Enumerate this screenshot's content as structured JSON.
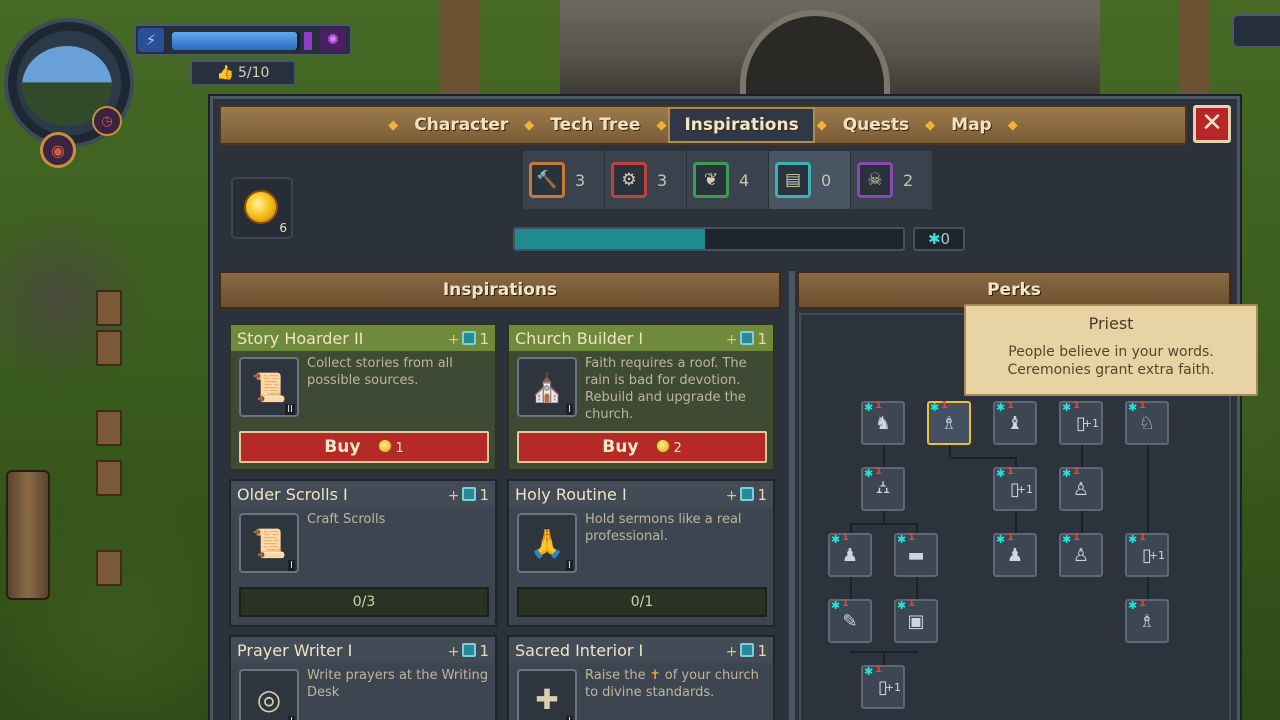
{
  "hud": {
    "energy_fraction": 0.98,
    "reputation": "5/10"
  },
  "nav": {
    "tabs": [
      {
        "label": "Character",
        "active": false
      },
      {
        "label": "Tech Tree",
        "active": false
      },
      {
        "label": "Inspirations",
        "active": true
      },
      {
        "label": "Quests",
        "active": false
      },
      {
        "label": "Map",
        "active": false
      }
    ],
    "close_icon": "close-icon"
  },
  "categories": [
    {
      "icon": "hammer-icon",
      "count": "3",
      "color": "#c77a36"
    },
    {
      "icon": "gear-icon",
      "count": "3",
      "color": "#c0423a"
    },
    {
      "icon": "wheat-icon",
      "count": "4",
      "color": "#3f9a52"
    },
    {
      "icon": "book-icon",
      "count": "0",
      "color": "#3eb0b8"
    },
    {
      "icon": "skull-icon",
      "count": "2",
      "color": "#8a4ab2"
    }
  ],
  "currency": {
    "orb_count": "6"
  },
  "progress": {
    "fraction": 0.49,
    "xp": "0"
  },
  "sections": {
    "inspirations": "Inspirations",
    "perks": "Perks"
  },
  "cards": [
    {
      "title": "Story Hoarder II",
      "plus": "1",
      "desc": "Collect stories from all possible sources.",
      "badge": "II",
      "icon": "scroll-icon",
      "style": "green",
      "action": "buy",
      "buy_label": "Buy",
      "cost": "1"
    },
    {
      "title": "Church Builder I",
      "plus": "1",
      "desc": "Faith requires a roof. The rain is bad for devotion. Rebuild and upgrade the church.",
      "badge": "I",
      "icon": "church-icon",
      "style": "green",
      "action": "buy",
      "buy_label": "Buy",
      "cost": "2"
    },
    {
      "title": "Older Scrolls I",
      "plus": "1",
      "desc": "Craft Scrolls",
      "badge": "I",
      "icon": "parchment-icon",
      "style": "grey",
      "action": "progress",
      "progress": "0/3"
    },
    {
      "title": "Holy Routine I",
      "plus": "1",
      "desc": "Hold sermons like a real professional.",
      "badge": "I",
      "icon": "prayer-hands-icon",
      "style": "grey",
      "action": "progress",
      "progress": "0/1"
    },
    {
      "title": "Prayer Writer I",
      "plus": "1",
      "desc": "Write prayers at the Writing Desk",
      "badge": "I",
      "icon": "swirl-orb-icon",
      "style": "grey",
      "action": "none"
    },
    {
      "title": "Sacred Interior I",
      "plus": "1",
      "desc_pre": "Raise the",
      "desc_post": "of your church to divine standards.",
      "badge": "I",
      "icon": "church-interior-icon",
      "style": "grey",
      "action": "none"
    }
  ],
  "tooltip": {
    "title": "Priest",
    "desc_line1": "People believe in your words.",
    "desc_line2": "Ceremonies grant extra faith."
  },
  "perks": [
    {
      "col": 0,
      "row": 0,
      "num": "1",
      "icon": "knight-icon",
      "plus": ""
    },
    {
      "col": 1,
      "row": 0,
      "num": "1",
      "icon": "priest-icon",
      "plus": "",
      "selected": true
    },
    {
      "col": 2,
      "row": 0,
      "num": "1",
      "icon": "monk-icon",
      "plus": ""
    },
    {
      "col": 3,
      "row": 0,
      "num": "1",
      "icon": "scroll-perk-icon",
      "plus": "+1"
    },
    {
      "col": 4,
      "row": 0,
      "num": "1",
      "icon": "cleric-icon",
      "plus": ""
    },
    {
      "col": 0,
      "row": 1,
      "num": "1",
      "icon": "altar-icon",
      "plus": ""
    },
    {
      "col": 2,
      "row": 1,
      "num": "1",
      "icon": "scroll-perk-icon",
      "plus": "+1"
    },
    {
      "col": 3,
      "row": 1,
      "num": "1",
      "icon": "preacher-icon",
      "plus": ""
    },
    {
      "col": -0.5,
      "row": 2,
      "num": "1",
      "icon": "villager-icon",
      "plus": ""
    },
    {
      "col": 0.5,
      "row": 2,
      "num": "1",
      "icon": "pulpit-icon",
      "plus": ""
    },
    {
      "col": 2,
      "row": 2,
      "num": "1",
      "icon": "worker-icon",
      "plus": ""
    },
    {
      "col": 3,
      "row": 2,
      "num": "1",
      "icon": "acolyte-icon",
      "plus": ""
    },
    {
      "col": 4,
      "row": 2,
      "num": "1",
      "icon": "scroll-perk-icon",
      "plus": "+1"
    },
    {
      "col": -0.5,
      "row": 3,
      "num": "1",
      "icon": "scribe-icon",
      "plus": ""
    },
    {
      "col": 0.5,
      "row": 3,
      "num": "1",
      "icon": "chest-icon",
      "plus": ""
    },
    {
      "col": 4,
      "row": 3,
      "num": "1",
      "icon": "bishop-icon",
      "plus": ""
    },
    {
      "col": 0,
      "row": 4,
      "num": "1",
      "icon": "scroll-perk-icon",
      "plus": "+1"
    }
  ]
}
